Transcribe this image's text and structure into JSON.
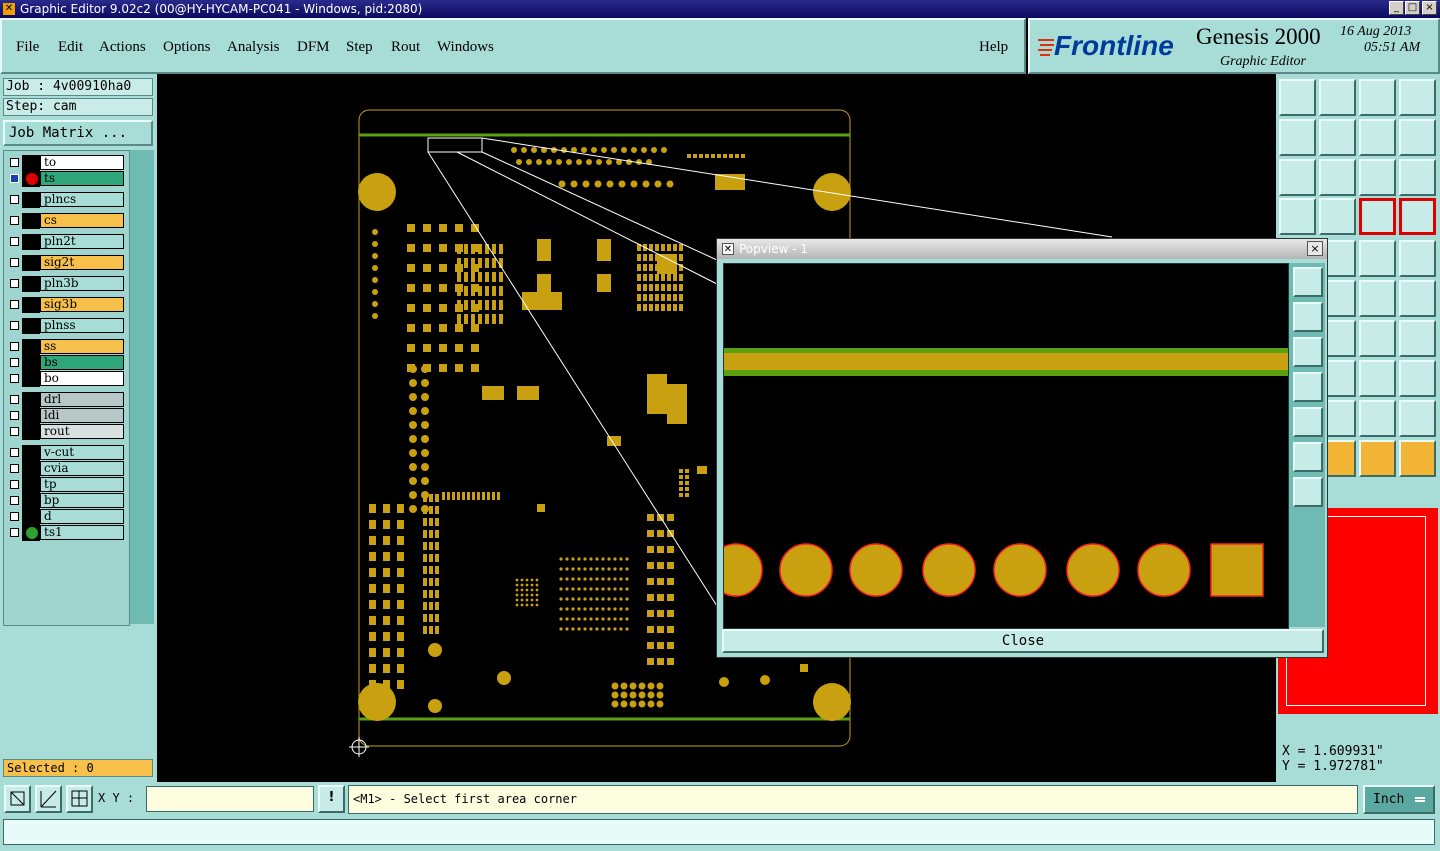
{
  "window": {
    "title": "Graphic Editor 9.02c2 (00@HY-HYCAM-PC041 - Windows, pid:2080)",
    "controls": [
      "_",
      "□",
      "×"
    ]
  },
  "menu": {
    "items": [
      "File",
      "Edit",
      "Actions",
      "Options",
      "Analysis",
      "DFM",
      "Step",
      "Rout",
      "Windows"
    ],
    "help": "Help"
  },
  "brand": {
    "logo": "Frontline",
    "product": "Genesis 2000",
    "subtitle": "Graphic Editor",
    "date": "16 Aug 2013",
    "time": "05:51 AM"
  },
  "job": {
    "job_label": "Job : 4v00910ha0",
    "step_label": "Step: cam",
    "matrix_button": "Job Matrix ..."
  },
  "layers": [
    {
      "name": "to",
      "color": "#ffffff"
    },
    {
      "name": "ts",
      "color": "#2fa77a",
      "active": true
    },
    {
      "name": "plncs",
      "color": "#a7dcd7"
    },
    {
      "name": "cs",
      "color": "#f7c04a"
    },
    {
      "name": "pln2t",
      "color": "#a7dcd7"
    },
    {
      "name": "sig2t",
      "color": "#f7c04a"
    },
    {
      "name": "pln3b",
      "color": "#a7dcd7"
    },
    {
      "name": "sig3b",
      "color": "#f7c04a"
    },
    {
      "name": "plnss",
      "color": "#a7dcd7"
    },
    {
      "name": "ss",
      "color": "#f7c04a"
    },
    {
      "name": "bs",
      "color": "#2fa77a"
    },
    {
      "name": "bo",
      "color": "#ffffff"
    },
    {
      "name": "drl",
      "color": "#b7c6c6"
    },
    {
      "name": "ldi",
      "color": "#b7c6c6"
    },
    {
      "name": "rout",
      "color": "#d8e0e0"
    },
    {
      "name": "v-cut",
      "color": "#a7dcd7"
    },
    {
      "name": "cvia",
      "color": "#a7dcd7"
    },
    {
      "name": "tp",
      "color": "#a7dcd7"
    },
    {
      "name": "bp",
      "color": "#a7dcd7"
    },
    {
      "name": "d",
      "color": "#a7dcd7"
    },
    {
      "name": "ts1",
      "color": "#a7dcd7"
    }
  ],
  "selected_label": "Selected : 0",
  "popview": {
    "title": "Popview - 1",
    "close_label": "Close"
  },
  "coords": {
    "x": "X = 1.609931\"",
    "y": "Y = 1.972781\""
  },
  "bottom": {
    "xy_label": "X Y :",
    "xy_value": "",
    "prompt": "<M1> - Select first area corner",
    "units": "Inch"
  },
  "colors": {
    "pad": "#c8a010",
    "pad_outline": "#ff2020",
    "trace_green": "#5aa010",
    "panel": "#a7dcd7"
  }
}
